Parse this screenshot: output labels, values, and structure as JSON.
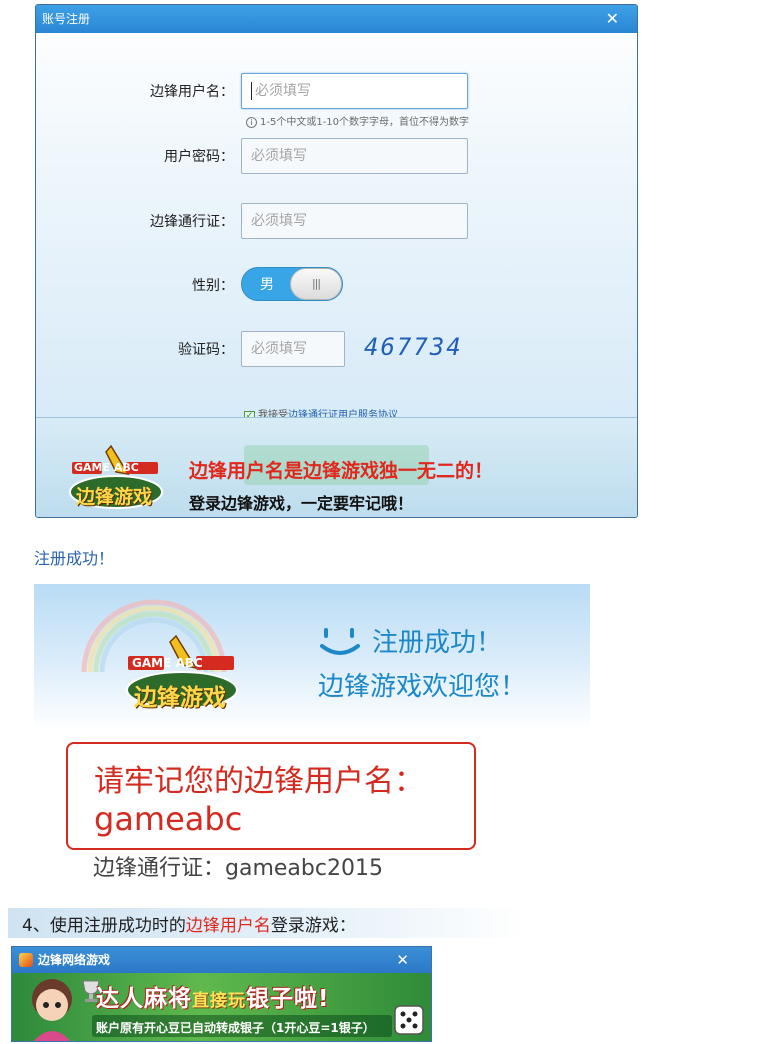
{
  "dialog": {
    "title": "账号注册",
    "close_glyph": "✕",
    "fields": {
      "username_label": "边锋用户名：",
      "username_placeholder": "必须填写",
      "username_hint": "1-5个中文或1-10个数字字母，首位不得为数字",
      "password_label": "用户密码：",
      "password_placeholder": "必须填写",
      "passport_label": "边锋通行证：",
      "passport_placeholder": "必须填写",
      "gender_label": "性别：",
      "gender_value": "男",
      "captcha_label": "验证码：",
      "captcha_placeholder": "必须填写",
      "captcha_code": "467734"
    },
    "agree_prefix": "我接受",
    "agree_link": "边锋通行证用户服务协议",
    "banner_line1": "边锋用户名是边锋游戏独一无二的！",
    "banner_line2": "登录边锋游戏，一定要牢记哦！",
    "logo_text_top": "GAME ABC",
    "logo_text_main": "边锋游戏"
  },
  "success": {
    "caption": "注册成功！",
    "title": "注册成功！",
    "welcome": "边锋游戏欢迎您！",
    "remember_label": "请牢记您的边锋用户名：",
    "remember_value": "gameabc",
    "passport_line": "边锋通行证：gameabc2015"
  },
  "step4": {
    "prefix": "4、使用注册成功时的",
    "highlight": "边锋用户名",
    "suffix": "登录游戏："
  },
  "mini_window": {
    "title": "边锋网络游戏",
    "close_glyph": "✕",
    "ad_title_a": "达人麻将",
    "ad_title_b": "直接玩",
    "ad_title_c": "银子啦!",
    "ad_sub": "账户原有开心豆已自动转成银子（1开心豆=1银子）"
  },
  "colors": {
    "accent_blue": "#2a86d4",
    "alert_red": "#e0281c",
    "success_blue": "#1d88c8"
  }
}
